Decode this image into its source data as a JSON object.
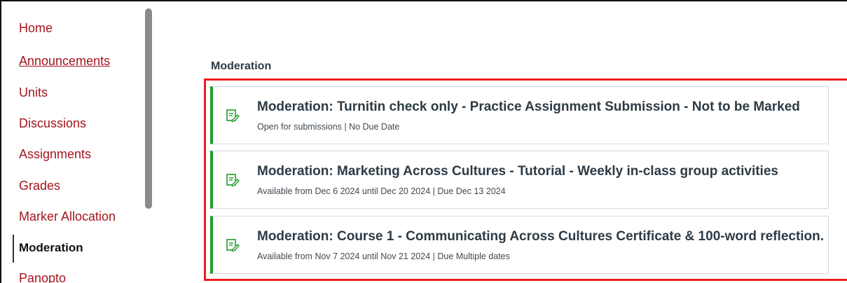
{
  "sidebar": {
    "items": [
      {
        "label": "Home"
      },
      {
        "label": "Announcements"
      },
      {
        "label": "Units"
      },
      {
        "label": "Discussions"
      },
      {
        "label": "Assignments"
      },
      {
        "label": "Grades"
      },
      {
        "label": "Marker Allocation"
      },
      {
        "label": "Moderation"
      },
      {
        "label": "Panopto"
      }
    ]
  },
  "main": {
    "section_title": "Moderation",
    "assignments": [
      {
        "icon": "assignment-icon",
        "title": "Moderation: Turnitin check only - Practice Assignment Submission - Not to be Marked",
        "meta": "Open for submissions | No Due Date"
      },
      {
        "icon": "assignment-icon",
        "title": "Moderation: Marketing Across Cultures - Tutorial - Weekly in-class group activities",
        "meta": "Available from Dec 6 2024 until Dec 20 2024 | Due Dec 13 2024"
      },
      {
        "icon": "assignment-icon",
        "title": "Moderation: Course 1 - Communicating Across Cultures Certificate & 100-word reflection.",
        "meta": "Available from Nov 7 2024 until Nov 21 2024 | Due Multiple dates"
      }
    ]
  },
  "colors": {
    "nav_link": "#a4151c",
    "card_accent": "#1f9b2a",
    "highlight": "#ee1c1c"
  }
}
